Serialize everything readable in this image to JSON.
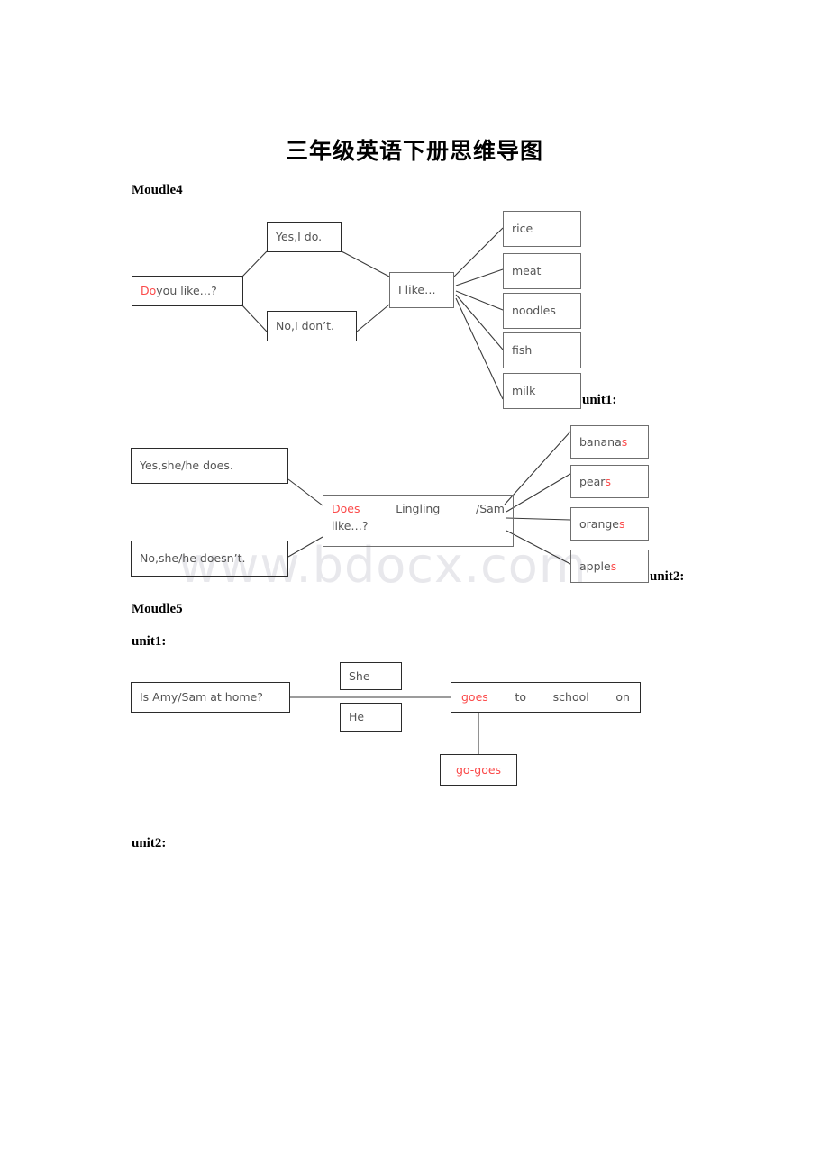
{
  "document": {
    "title": "三年级英语下册思维导图",
    "watermark": "www.bdocx.com",
    "module4_label": "Moudle4",
    "module5_label": "Moudle5",
    "module5_unit1_label": "unit1:",
    "module5_unit2_label": "unit2:",
    "diagram1_unit_label": "unit1:",
    "diagram2_unit_label": "unit2:"
  },
  "diagram1": {
    "root": {
      "red_word": "Do",
      "rest": " you like…?"
    },
    "yes_branch": "Yes,I do.",
    "no_branch": "No,I don’t.",
    "hub": "I like…",
    "items": [
      "rice",
      "meat",
      "noodles",
      "fish",
      "milk"
    ]
  },
  "diagram2": {
    "yes_branch": "Yes,she/he does.",
    "no_branch": "No,she/he doesn’t.",
    "hub": {
      "red_word": "Does",
      "word2": "Lingling",
      "word3": "/Sam",
      "line2": "like…?"
    },
    "items": [
      {
        "stem": "banana",
        "plural": "s"
      },
      {
        "stem": "pear",
        "plural": "s"
      },
      {
        "stem": "orange",
        "plural": "s"
      },
      {
        "stem": "apple",
        "plural": "s"
      }
    ]
  },
  "diagram3": {
    "question": "Is Amy/Sam at home?",
    "subject_she": "She",
    "subject_he": "He",
    "predicate": {
      "red_word": "goes",
      "word2": "to",
      "word3": "school",
      "word4": "on"
    },
    "verb_note": "go-goes"
  },
  "colors": {
    "red": "#fb4a4a",
    "box_border": "#6f6f6f",
    "text": "#545454",
    "watermark": "#e8e8ec"
  }
}
